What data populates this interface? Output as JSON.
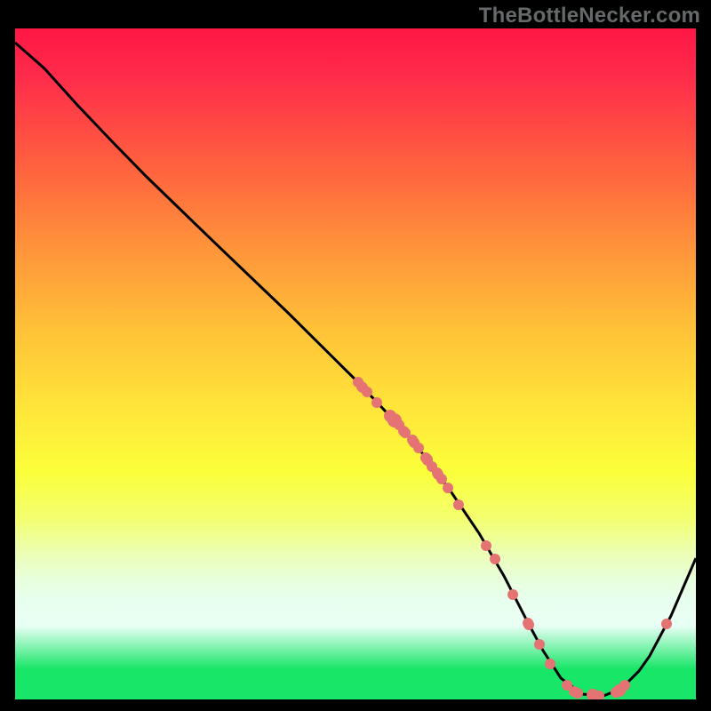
{
  "watermark": "TheBottleNecker.com",
  "chart_data": {
    "type": "line",
    "title": "",
    "xlabel": "",
    "ylabel": "",
    "xlim": [
      0,
      100
    ],
    "ylim": [
      0,
      100
    ],
    "curve": {
      "x": [
        0.0,
        4.3,
        9.0,
        14.09,
        19.32,
        29.44,
        39.96,
        50.22,
        58.13,
        61.0,
        64.0,
        68.15,
        71.8,
        75.29,
        77.55,
        80.16,
        83.29,
        86.42,
        89.03,
        91.64,
        93.21,
        96.34,
        100.0
      ],
      "y": [
        97.88,
        94.04,
        88.74,
        83.31,
        77.88,
        67.95,
        57.75,
        47.42,
        38.94,
        35.1,
        30.99,
        24.77,
        18.41,
        11.52,
        7.28,
        3.18,
        0.79,
        0.53,
        1.59,
        4.24,
        6.49,
        12.45,
        21.06
      ]
    },
    "markers": [
      {
        "x": 50.39,
        "y": 47.28,
        "r": 6
      },
      {
        "x": 50.91,
        "y": 46.62,
        "r": 6
      },
      {
        "x": 51.04,
        "y": 46.49,
        "r": 6
      },
      {
        "x": 51.7,
        "y": 45.83,
        "r": 6
      },
      {
        "x": 53.13,
        "y": 44.24,
        "r": 6
      },
      {
        "x": 55.09,
        "y": 42.25,
        "r": 7
      },
      {
        "x": 55.22,
        "y": 42.12,
        "r": 6
      },
      {
        "x": 55.35,
        "y": 41.85,
        "r": 6
      },
      {
        "x": 55.74,
        "y": 41.59,
        "r": 8
      },
      {
        "x": 56.4,
        "y": 40.93,
        "r": 6
      },
      {
        "x": 57.05,
        "y": 40.0,
        "r": 6
      },
      {
        "x": 57.31,
        "y": 39.74,
        "r": 6
      },
      {
        "x": 58.36,
        "y": 38.68,
        "r": 6
      },
      {
        "x": 58.62,
        "y": 38.28,
        "r": 6
      },
      {
        "x": 59.27,
        "y": 37.48,
        "r": 6
      },
      {
        "x": 60.31,
        "y": 36.03,
        "r": 6
      },
      {
        "x": 60.44,
        "y": 35.89,
        "r": 6
      },
      {
        "x": 60.57,
        "y": 35.76,
        "r": 6
      },
      {
        "x": 60.57,
        "y": 35.63,
        "r": 6
      },
      {
        "x": 61.23,
        "y": 34.7,
        "r": 6
      },
      {
        "x": 62.01,
        "y": 33.77,
        "r": 6
      },
      {
        "x": 62.14,
        "y": 33.51,
        "r": 6
      },
      {
        "x": 62.66,
        "y": 32.85,
        "r": 6
      },
      {
        "x": 63.58,
        "y": 31.52,
        "r": 6
      },
      {
        "x": 65.14,
        "y": 29.01,
        "r": 6
      },
      {
        "x": 69.19,
        "y": 22.91,
        "r": 6
      },
      {
        "x": 70.5,
        "y": 20.93,
        "r": 6
      },
      {
        "x": 73.11,
        "y": 15.63,
        "r": 6
      },
      {
        "x": 75.33,
        "y": 11.39,
        "r": 6
      },
      {
        "x": 75.46,
        "y": 11.13,
        "r": 6
      },
      {
        "x": 77.02,
        "y": 8.21,
        "r": 6
      },
      {
        "x": 78.59,
        "y": 5.3,
        "r": 6
      },
      {
        "x": 81.07,
        "y": 2.12,
        "r": 6
      },
      {
        "x": 82.11,
        "y": 1.19,
        "r": 6
      },
      {
        "x": 82.64,
        "y": 0.93,
        "r": 6
      },
      {
        "x": 84.86,
        "y": 0.66,
        "r": 7
      },
      {
        "x": 85.25,
        "y": 0.53,
        "r": 6
      },
      {
        "x": 85.77,
        "y": 0.53,
        "r": 6
      },
      {
        "x": 88.25,
        "y": 1.06,
        "r": 6
      },
      {
        "x": 88.77,
        "y": 1.32,
        "r": 7
      },
      {
        "x": 89.03,
        "y": 1.59,
        "r": 6
      },
      {
        "x": 89.56,
        "y": 2.12,
        "r": 6
      },
      {
        "x": 95.69,
        "y": 11.26,
        "r": 6
      }
    ],
    "marker_color": "#e57373",
    "line_color": "#000000",
    "line_width": 3
  }
}
